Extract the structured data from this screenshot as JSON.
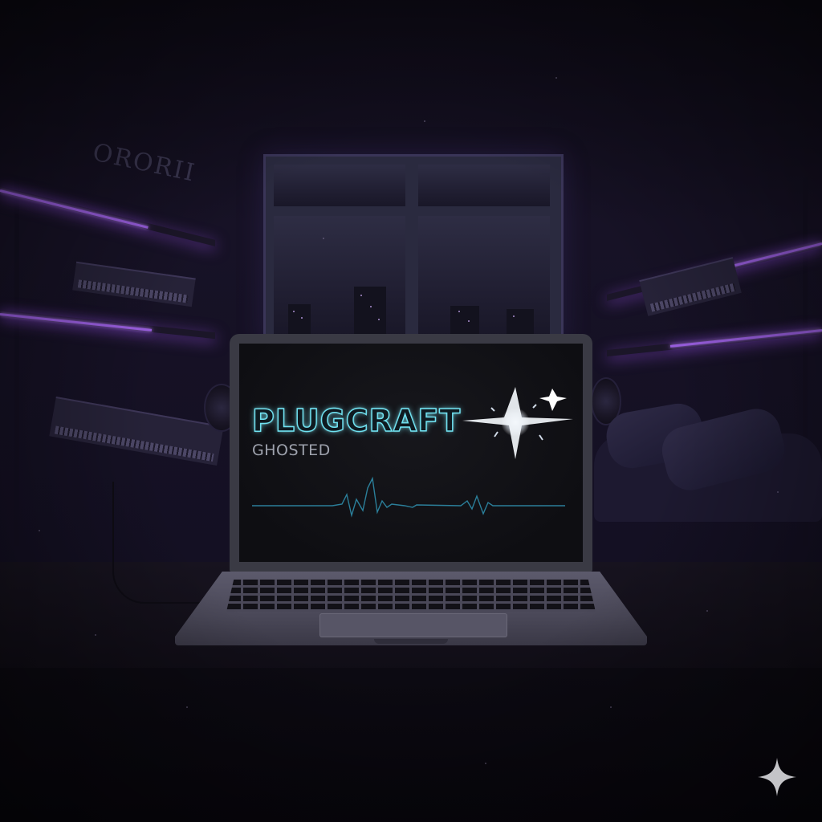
{
  "screen": {
    "title": "PLUGCRAFT",
    "subtitle": "GHOSTED"
  },
  "shelf_letters": "ORORII",
  "colors": {
    "neon_text": "#6fe3f2",
    "shelf_glow": "#b06bff",
    "subtitle": "#9ea2ad",
    "waveform": "#2b7f9a"
  },
  "icons": {
    "screen_flare": "sparkle-flare-icon",
    "corner_mark": "four-point-star-icon"
  }
}
